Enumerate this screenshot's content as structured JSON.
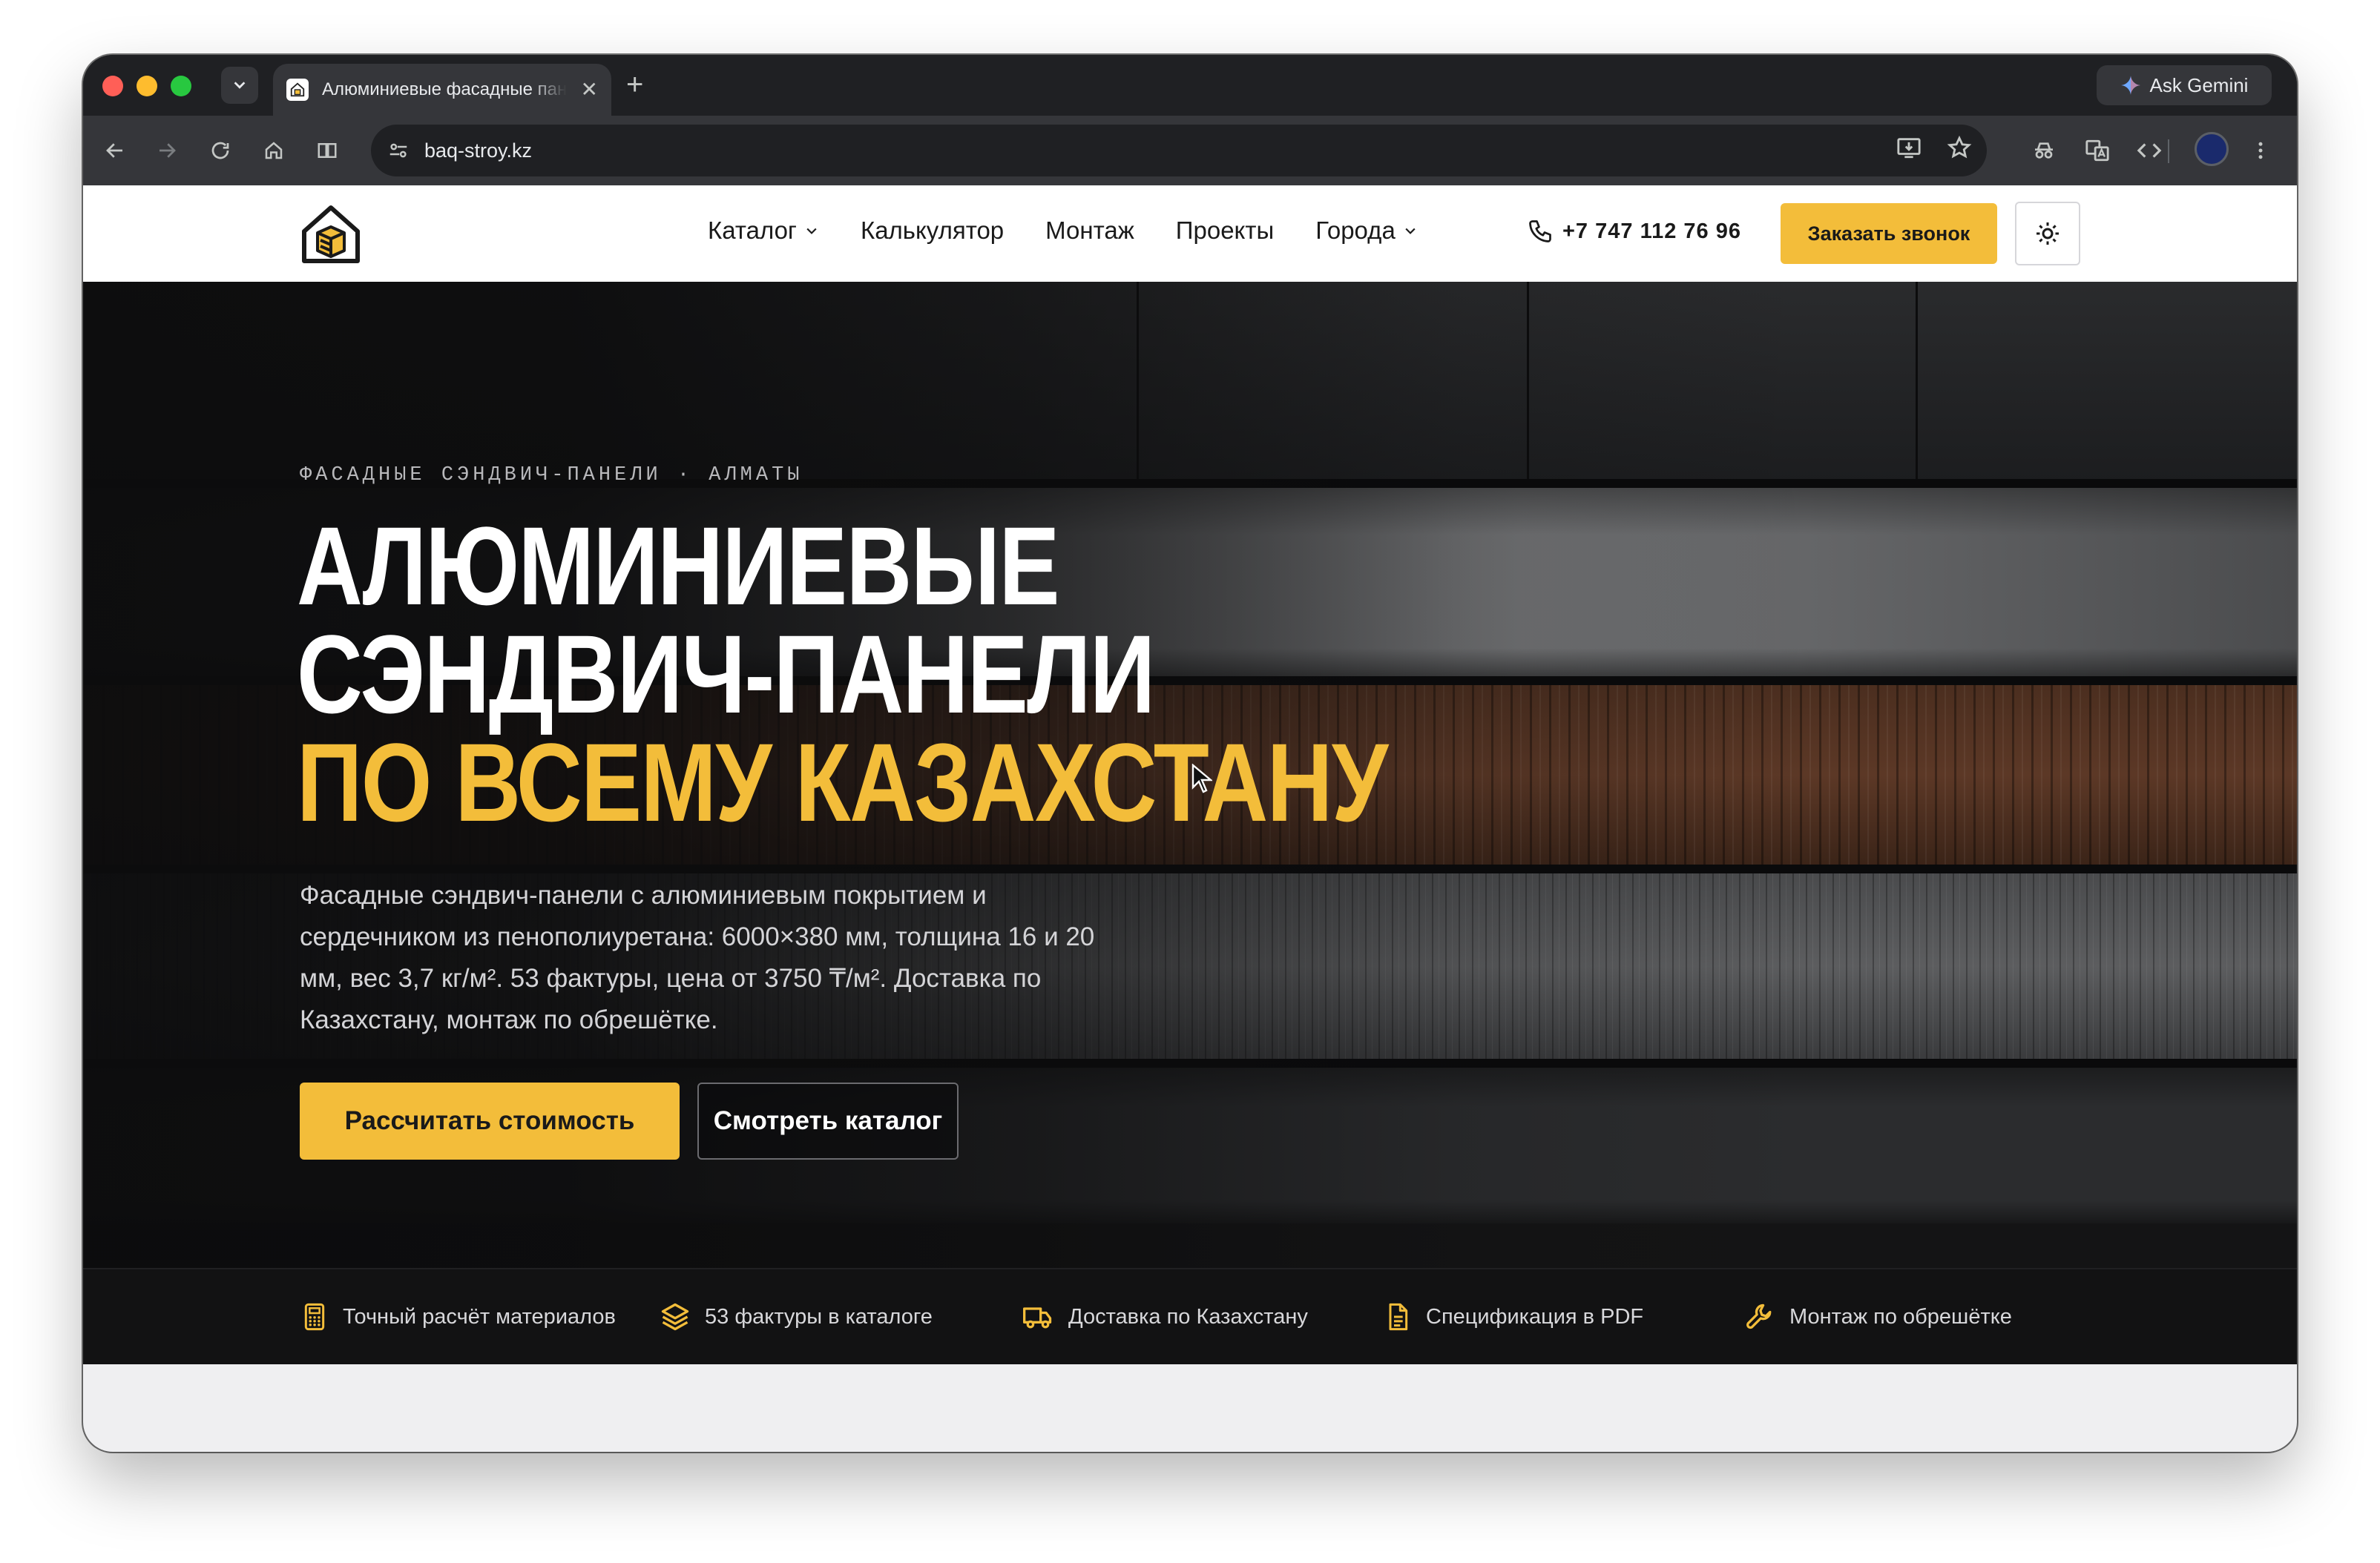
{
  "browser": {
    "tab": {
      "title": "Алюминиевые фасадные панели",
      "favicon": "site-logo-icon"
    },
    "new_tab_icon": "plus-icon",
    "ask_gemini_label": "Ask Gemini",
    "url": "baq-stroy.kz",
    "nav_icons": [
      "back-icon",
      "forward-icon",
      "reload-icon",
      "home-icon",
      "split-view-icon",
      "site-info-icon"
    ],
    "action_icons": [
      "install-app-icon",
      "star-icon",
      "incognito-icon",
      "translate-icon",
      "devtools-icon",
      "avatar",
      "more-icon"
    ]
  },
  "header": {
    "nav": [
      {
        "label": "Каталог",
        "has_dropdown": true
      },
      {
        "label": "Калькулятор",
        "has_dropdown": false
      },
      {
        "label": "Монтаж",
        "has_dropdown": false
      },
      {
        "label": "Проекты",
        "has_dropdown": false
      },
      {
        "label": "Города",
        "has_dropdown": true
      }
    ],
    "phone": "+7 747 112 76 96",
    "call_button": "Заказать звонок",
    "theme_toggle_icon": "sun-icon"
  },
  "hero": {
    "eyebrow": "ФАСАДНЫЕ СЭНДВИЧ-ПАНЕЛИ · АЛМАТЫ",
    "title_line1": "АЛЮМИНИЕВЫЕ",
    "title_line2": "СЭНДВИЧ-ПАНЕЛИ",
    "title_line3": "ПО ВСЕМУ КАЗАХСТАНУ",
    "description": "Фасадные сэндвич-панели с алюминиевым покрытием и сердечником из пенополиуретана: 6000×380 мм, толщина 16 и 20 мм, вес 3,7 кг/м². 53 фактуры, цена от 3750 ₸/м². Доставка по Казахстану, монтаж по обрешётке.",
    "primary_button": "Рассчитать стоимость",
    "secondary_button": "Смотреть каталог"
  },
  "features": [
    {
      "icon": "calculator-icon",
      "label": "Точный расчёт материалов"
    },
    {
      "icon": "layers-icon",
      "label": "53 фактуры в каталоге"
    },
    {
      "icon": "truck-icon",
      "label": "Доставка по Казахстану"
    },
    {
      "icon": "document-icon",
      "label": "Спецификация в PDF"
    },
    {
      "icon": "wrench-icon",
      "label": "Монтаж по обрешётке"
    }
  ],
  "colors": {
    "accent": "#f3bd3a",
    "hero_background": "#121213",
    "header_background": "#ffffff",
    "browser_chrome": "#35363a"
  }
}
